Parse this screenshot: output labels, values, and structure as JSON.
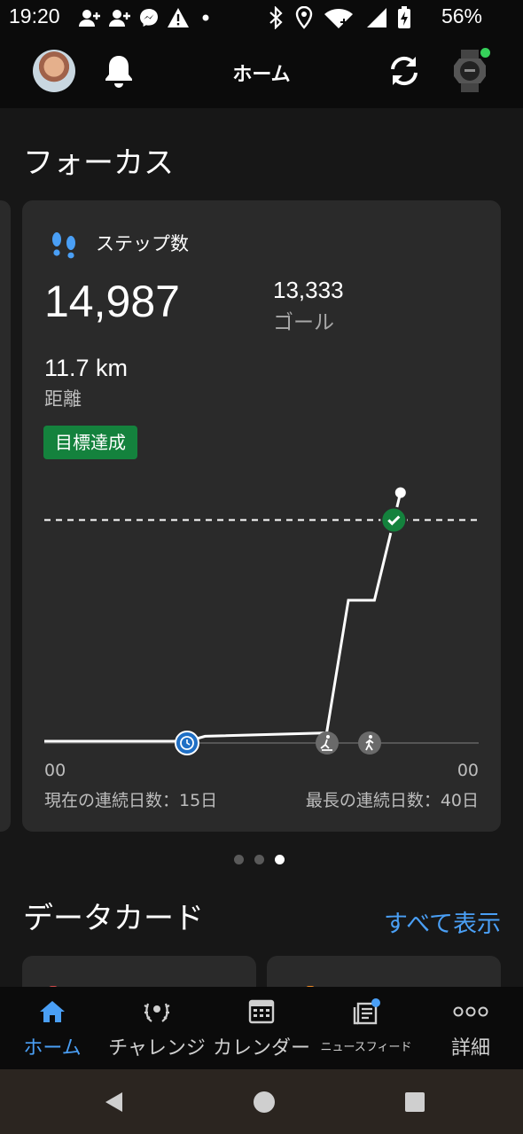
{
  "status_bar": {
    "time": "19:20",
    "battery": "56%"
  },
  "header": {
    "title": "ホーム"
  },
  "focus": {
    "section_title": "フォーカス",
    "card": {
      "label": "ステップ数",
      "steps": "14,987",
      "goal_value": "13,333",
      "goal_label": "ゴール",
      "distance_value": "11.7 km",
      "distance_label": "距離",
      "badge": "目標達成",
      "axis_left": "00",
      "axis_right": "00",
      "current_streak": "現在の連続日数：15日",
      "longest_streak": "最長の連続日数：40日"
    },
    "chart_data": {
      "type": "line",
      "title": "",
      "goal": 13333,
      "series": [
        {
          "values": [
            {
              "t": 0.0,
              "steps": 0
            },
            {
              "t": 0.33,
              "steps": 0
            },
            {
              "t": 0.37,
              "steps": 300
            },
            {
              "t": 0.65,
              "steps": 500
            },
            {
              "t": 0.7,
              "steps": 8500
            },
            {
              "t": 0.76,
              "steps": 8500
            },
            {
              "t": 0.82,
              "steps": 14987
            }
          ]
        }
      ]
    },
    "pager": {
      "count": 3,
      "active": 2
    }
  },
  "data_cards": {
    "section_title": "データカード",
    "see_all": "すべて表示"
  },
  "bottom_nav": {
    "items": [
      {
        "label": "ホーム",
        "icon": "home-icon",
        "active": true
      },
      {
        "label": "チャレンジ",
        "icon": "laurel-icon"
      },
      {
        "label": "カレンダー",
        "icon": "calendar-icon"
      },
      {
        "label": "ニュースフィード",
        "icon": "newsfeed-icon"
      },
      {
        "label": "詳細",
        "icon": "more-icon"
      }
    ]
  },
  "colors": {
    "accent": "#4a9ff5",
    "badge": "#14823d",
    "background": "#171717",
    "card": "#2a2a2a"
  }
}
